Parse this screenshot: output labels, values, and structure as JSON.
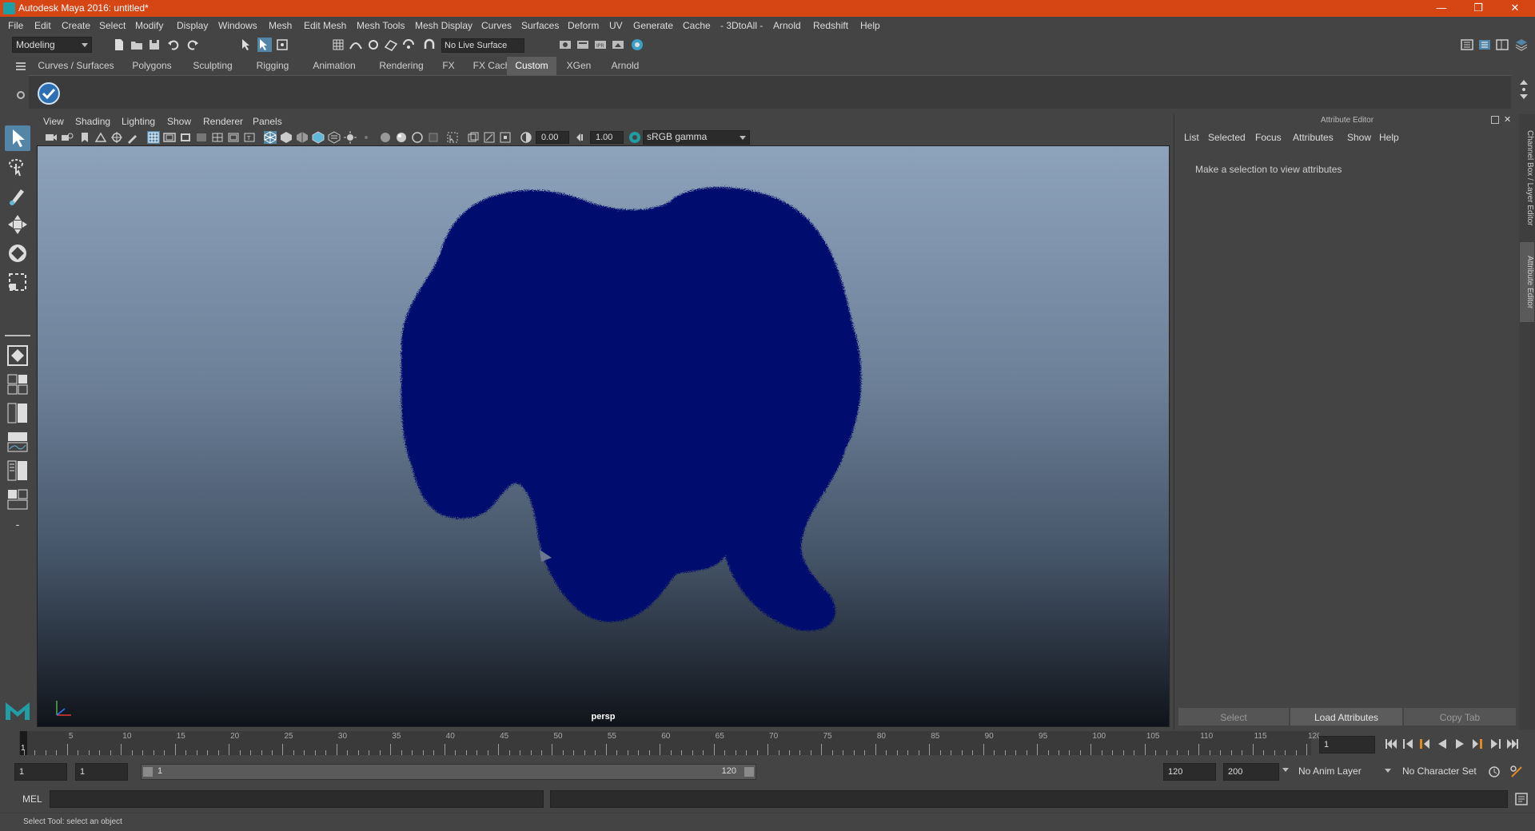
{
  "window": {
    "title": "Autodesk Maya 2016: untitled*"
  },
  "menus": [
    "File",
    "Edit",
    "Create",
    "Select",
    "Modify",
    "Display",
    "Windows",
    "Mesh",
    "Edit Mesh",
    "Mesh Tools",
    "Mesh Display",
    "Curves",
    "Surfaces",
    "Deform",
    "UV",
    "Generate",
    "Cache",
    "- 3DtoAll -",
    "Arnold",
    "Redshift",
    "Help"
  ],
  "status": {
    "mode": "Modeling",
    "live_surface": "No Live Surface"
  },
  "shelf": {
    "tabs": [
      "Curves / Surfaces",
      "Polygons",
      "Sculpting",
      "Rigging",
      "Animation",
      "Rendering",
      "FX",
      "FX Caching",
      "Custom",
      "XGen",
      "Arnold"
    ],
    "active_tab": "Custom"
  },
  "viewport": {
    "menus": [
      "View",
      "Shading",
      "Lighting",
      "Show",
      "Renderer",
      "Panels"
    ],
    "exposure": "0.00",
    "gamma": "1.00",
    "color_space": "sRGB gamma",
    "camera_label": "persp"
  },
  "attribute_editor": {
    "title": "Attribute Editor",
    "menus": [
      "List",
      "Selected",
      "Focus",
      "Attributes",
      "Show",
      "Help"
    ],
    "message": "Make a selection to view attributes",
    "buttons": {
      "select": "Select",
      "load": "Load Attributes",
      "copy": "Copy Tab"
    }
  },
  "side_tabs": {
    "channel_box": "Channel Box / Layer Editor",
    "attribute_editor": "Attribute Editor"
  },
  "timeline": {
    "tick_labels": [
      "1",
      "5",
      "10",
      "15",
      "20",
      "25",
      "30",
      "35",
      "40",
      "45",
      "50",
      "55",
      "60",
      "65",
      "70",
      "75",
      "80",
      "85",
      "90",
      "95",
      "100",
      "105",
      "110",
      "115",
      "120"
    ],
    "current_frame": "1"
  },
  "range": {
    "start": "1",
    "playback_start": "1",
    "range_start": "1",
    "range_end": "120",
    "playback_end": "120",
    "end": "200",
    "anim_layer": "No Anim Layer",
    "character_set": "No Character Set"
  },
  "command": {
    "label": "MEL"
  },
  "help_line": "Select Tool: select an object",
  "colors": {
    "titlebar": "#d64514",
    "panel": "#444444",
    "accent": "#5285a6",
    "mesh": "#000a6e"
  }
}
